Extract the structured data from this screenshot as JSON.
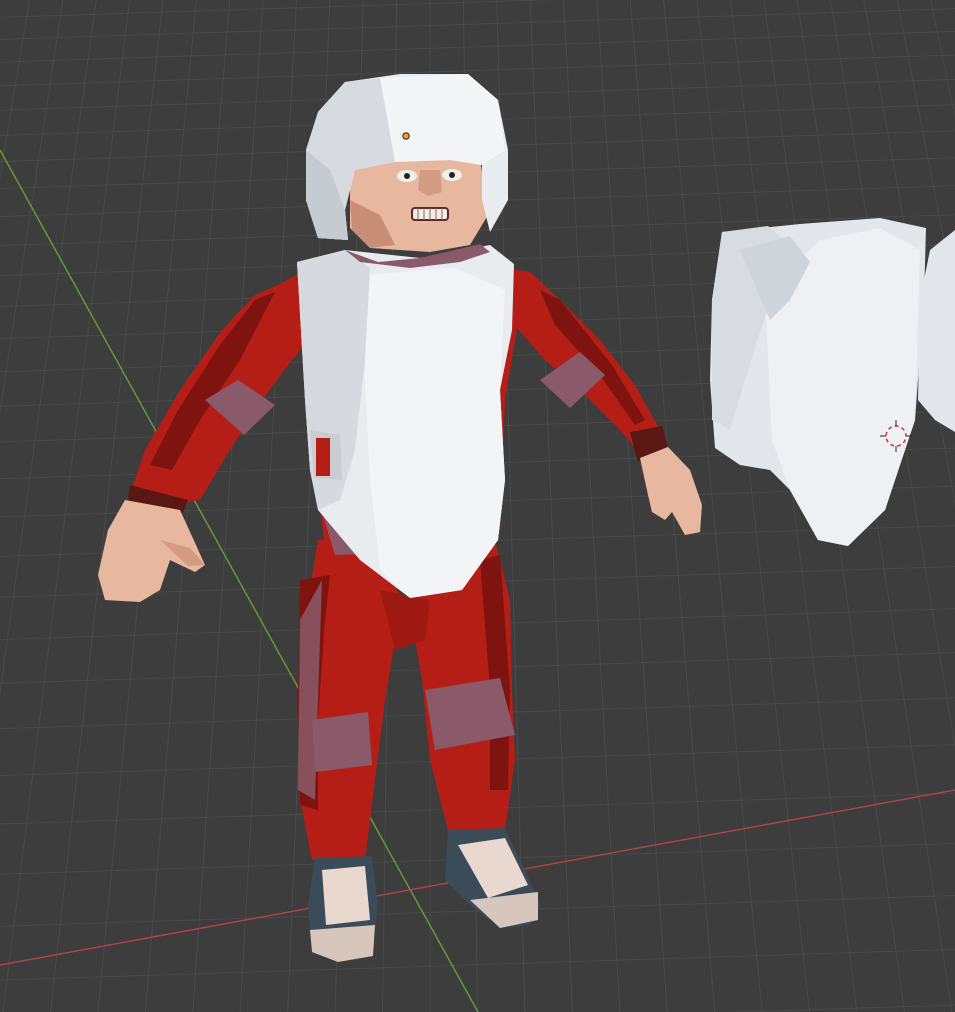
{
  "viewport": {
    "background": "#3d3d3d",
    "grid_color": "#4a4a4a",
    "x_axis_color": "#b2424b",
    "y_axis_color": "#6f9a37"
  },
  "character": {
    "suit_color": "#b51e16",
    "suit_shadow": "#7e1310",
    "armor_color": "#e9ecef",
    "armor_shadow": "#c9cdd2",
    "pad_color": "#8a5a6a",
    "skin_color": "#e9b9a1",
    "shoe_color": "#3c4b58",
    "laces_color": "#e8d8d0"
  },
  "detached_armor": {
    "color": "#e6e9ed",
    "shadow": "#c7ccd2"
  },
  "icons": [
    "3d-cursor-icon",
    "origin-point-icon"
  ]
}
